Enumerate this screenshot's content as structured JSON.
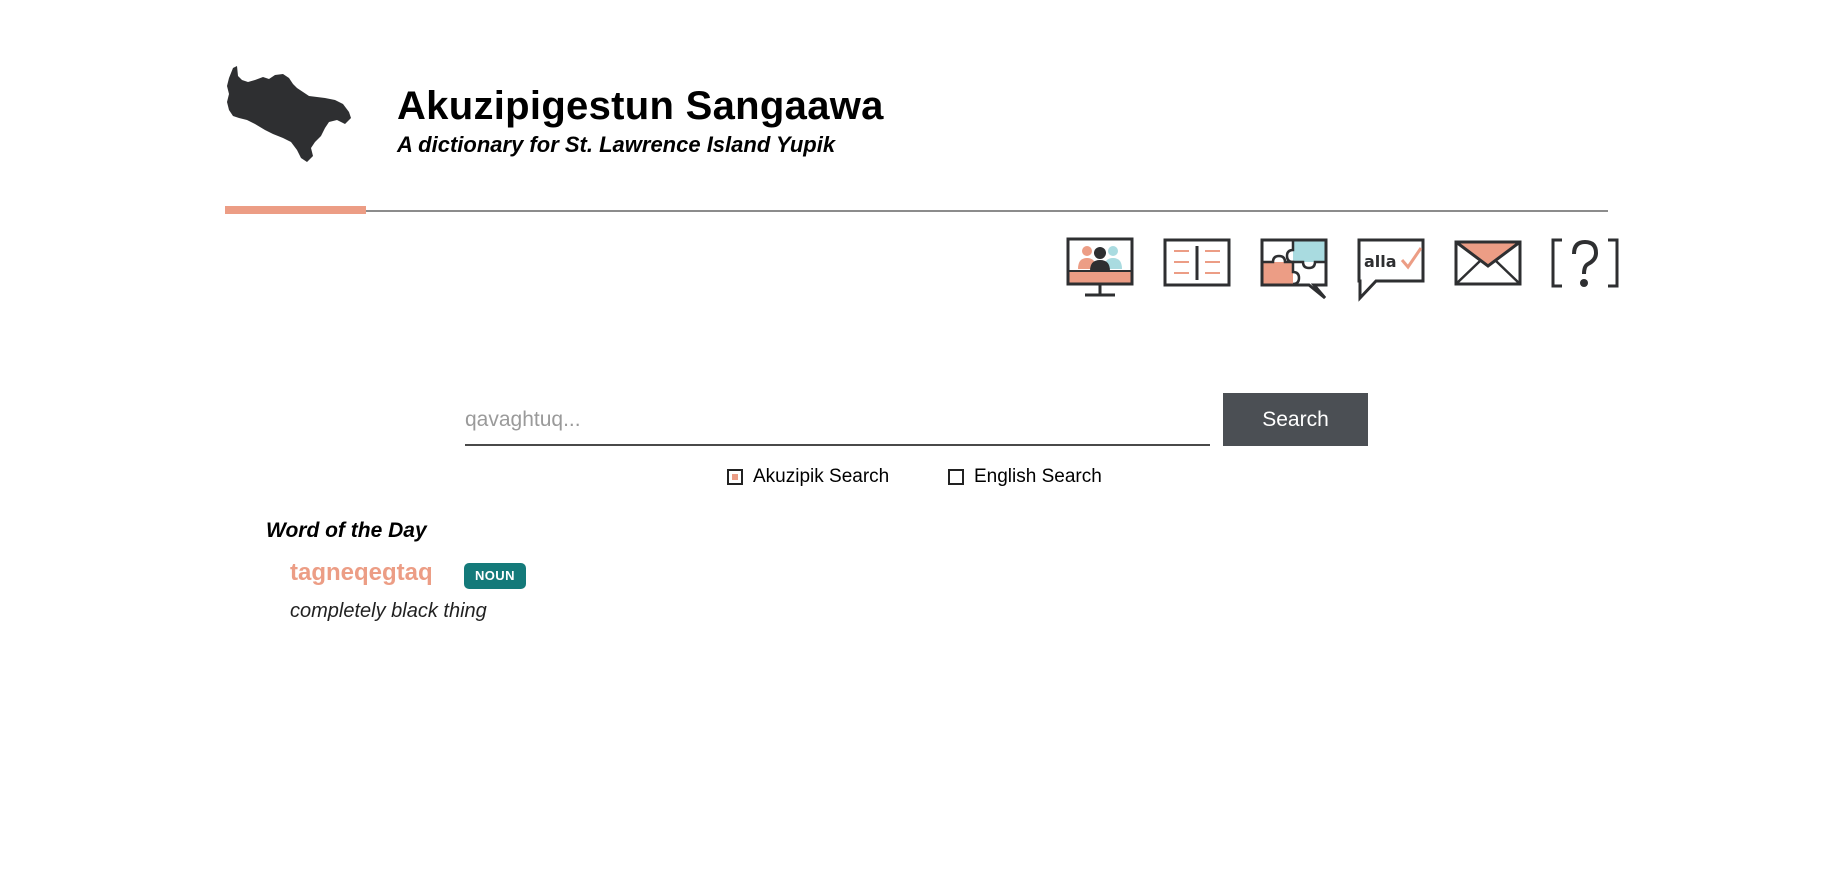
{
  "header": {
    "title": "Akuzipigestun Sangaawa",
    "subtitle": "A dictionary for St. Lawrence Island Yupik",
    "logo": "island-silhouette-logo"
  },
  "nav": {
    "icons": [
      "video-chat-icon",
      "dictionary-book-icon",
      "puzzle-icon",
      "alla-speech-icon",
      "mail-icon",
      "help-icon"
    ],
    "speech_text": "alla"
  },
  "search": {
    "placeholder": "qavaghtuq...",
    "value": "",
    "button_label": "Search",
    "options": [
      {
        "label": "Akuzipik Search",
        "checked": true
      },
      {
        "label": "English Search",
        "checked": false
      }
    ]
  },
  "word_of_day": {
    "heading": "Word of the Day",
    "word": "tagneqegtaq",
    "part_of_speech": "NOUN",
    "definition": "completely black thing"
  },
  "colors": {
    "accent": "#ec9d85",
    "teal": "#147a7a",
    "light_blue": "#a9dbe0",
    "dark": "#2e2f31",
    "button": "#4b4f54"
  }
}
